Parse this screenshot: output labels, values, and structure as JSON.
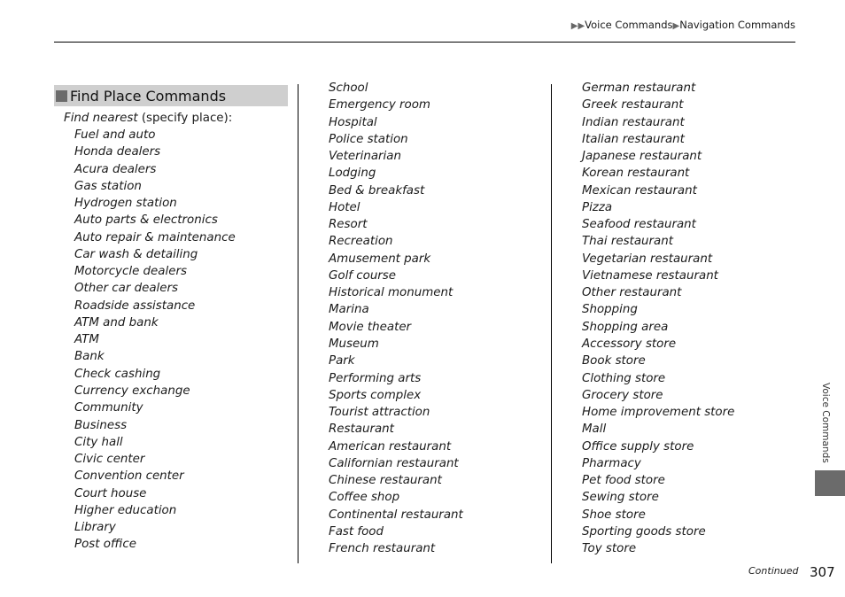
{
  "header": {
    "breadcrumb": [
      "Voice Commands",
      "Navigation Commands"
    ]
  },
  "section": {
    "title": "Find Place Commands",
    "intro_command": "Find nearest",
    "intro_suffix": " (specify place):"
  },
  "columns": [
    [
      "Fuel and auto",
      "Honda dealers",
      "Acura dealers",
      "Gas station",
      "Hydrogen station",
      "Auto parts & electronics",
      "Auto repair & maintenance",
      "Car wash & detailing",
      "Motorcycle dealers",
      "Other car dealers",
      "Roadside assistance",
      "ATM and bank",
      "ATM",
      "Bank",
      "Check cashing",
      "Currency exchange",
      "Community",
      "Business",
      "City hall",
      "Civic center",
      "Convention center",
      "Court house",
      "Higher education",
      "Library",
      "Post office"
    ],
    [
      "School",
      "Emergency room",
      "Hospital",
      "Police station",
      "Veterinarian",
      "Lodging",
      "Bed & breakfast",
      "Hotel",
      "Resort",
      "Recreation",
      "Amusement park",
      "Golf course",
      "Historical monument",
      "Marina",
      "Movie theater",
      "Museum",
      "Park",
      "Performing arts",
      "Sports complex",
      "Tourist attraction",
      "Restaurant",
      "American restaurant",
      "Californian restaurant",
      "Chinese restaurant",
      "Coffee shop",
      "Continental restaurant",
      "Fast food",
      "French restaurant"
    ],
    [
      "German restaurant",
      "Greek restaurant",
      "Indian restaurant",
      "Italian restaurant",
      "Japanese restaurant",
      "Korean restaurant",
      "Mexican restaurant",
      "Pizza",
      "Seafood restaurant",
      "Thai restaurant",
      "Vegetarian restaurant",
      "Vietnamese restaurant",
      "Other restaurant",
      "Shopping",
      "Shopping area",
      "Accessory store",
      "Book store",
      "Clothing store",
      "Grocery store",
      "Home improvement store",
      "Mall",
      "Office supply store",
      "Pharmacy",
      "Pet food store",
      "Sewing store",
      "Shoe store",
      "Sporting goods store",
      "Toy store"
    ]
  ],
  "side_tab": {
    "label": "Voice Commands"
  },
  "footer": {
    "continued": "Continued",
    "page_number": "307"
  },
  "colors": {
    "heading_bg": "#cfcfcf",
    "tab_gray": "#6b6b6b"
  }
}
